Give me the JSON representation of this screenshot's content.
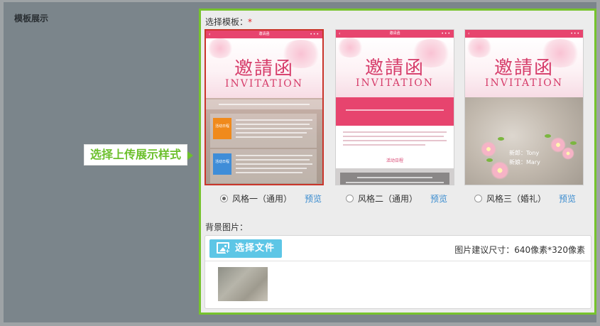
{
  "section": {
    "title": "模板展示"
  },
  "callout": {
    "text": "选择上传展示样式"
  },
  "template_picker": {
    "label": "选择模板：",
    "required_mark": "*",
    "templates": [
      {
        "name": "风格一（通用）",
        "selected": true,
        "preview": "预览",
        "thumb": {
          "bar_title": "邀请函",
          "title": "邀請函",
          "subtitle": "INVITATION",
          "tags": [
            "活动日程",
            "活动日程"
          ]
        }
      },
      {
        "name": "风格二（通用）",
        "selected": false,
        "preview": "预览",
        "thumb": {
          "bar_title": "邀请函",
          "title": "邀請函",
          "subtitle": "INVITATION",
          "section_heading": "活动日程"
        }
      },
      {
        "name": "风格三（婚礼）",
        "selected": false,
        "preview": "预览",
        "thumb": {
          "title": "邀請函",
          "subtitle": "INVITATION",
          "groom": "新郎：Tony",
          "bride": "新娘：Mary"
        }
      }
    ]
  },
  "background": {
    "label": "背景图片：",
    "choose_button": "选择文件",
    "size_hint": "图片建议尺寸：640像素*320像素"
  },
  "colors": {
    "accent_green": "#76c32d",
    "selected_border": "#c9352b",
    "invite_pink": "#e7446e",
    "upload_blue": "#5dc6e6",
    "link_blue": "#3a8ccf"
  }
}
